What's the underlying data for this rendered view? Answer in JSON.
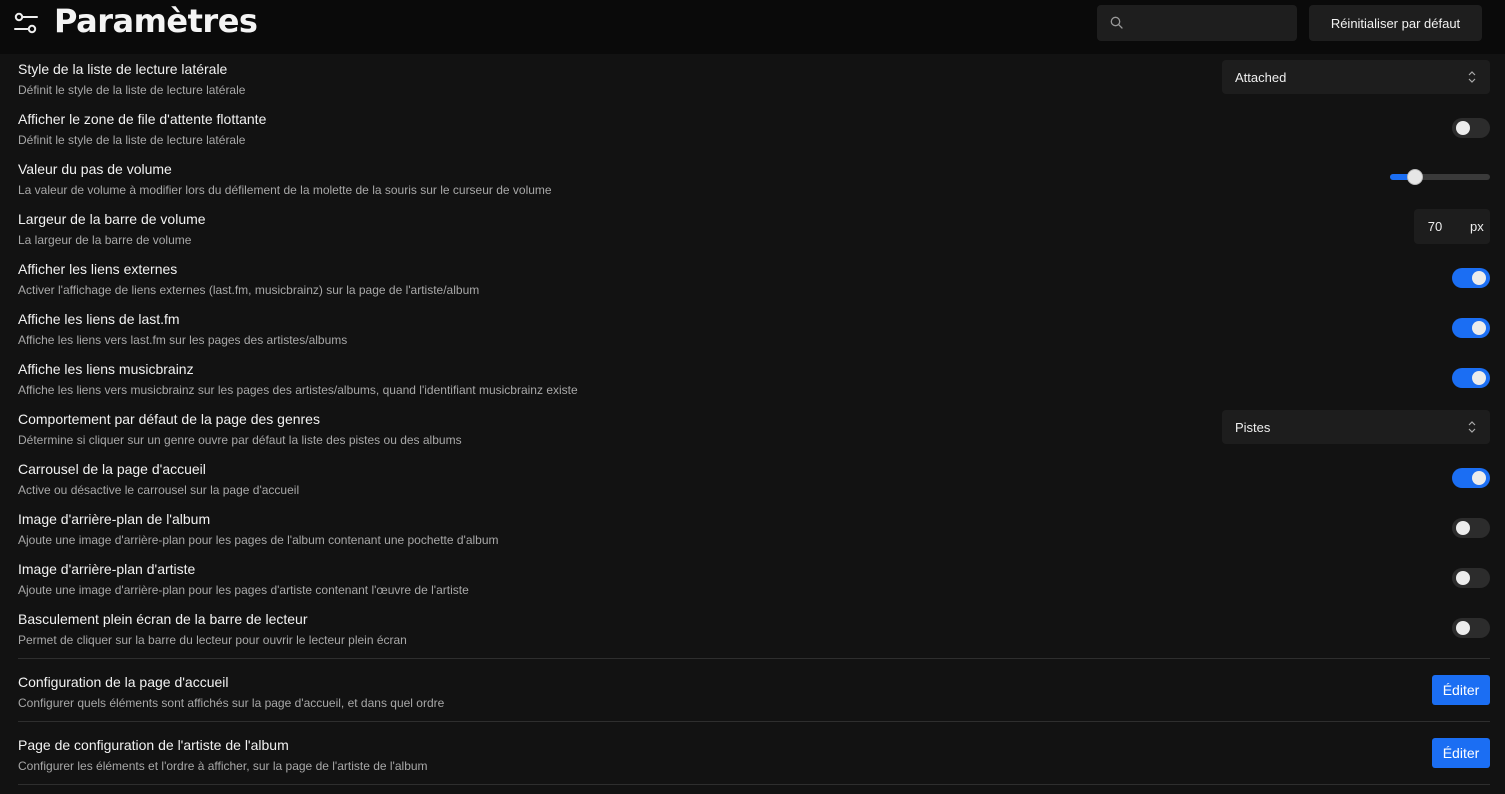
{
  "header": {
    "title": "Paramètres",
    "settings_icon": "sliders-icon",
    "search": {
      "placeholder": "",
      "value": "",
      "icon": "search-icon"
    },
    "reset_label": "Réinitialiser par défaut"
  },
  "settings": [
    {
      "title": "Style de la liste de lecture latérale",
      "description": "Définit le style de la liste de lecture latérale",
      "control": "select",
      "value": "Attached"
    },
    {
      "title": "Afficher le zone de file d'attente flottante",
      "description": "Définit le style de la liste de lecture latérale",
      "control": "toggle",
      "value": false
    },
    {
      "title": "Valeur du pas de volume",
      "description": "La valeur de volume à modifier lors du défilement de la molette de la souris sur le curseur de volume",
      "control": "slider",
      "value": 0.25
    },
    {
      "title": "Largeur de la barre de volume",
      "description": "La largeur de la barre de volume",
      "control": "number",
      "value": "70",
      "unit": "px"
    },
    {
      "title": "Afficher les liens externes",
      "description": "Activer l'affichage de liens externes (last.fm, musicbrainz) sur la page de l'artiste/album",
      "control": "toggle",
      "value": true
    },
    {
      "title": "Affiche les liens de last.fm",
      "description": "Affiche les liens vers last.fm sur les pages des artistes/albums",
      "control": "toggle",
      "value": true
    },
    {
      "title": "Affiche les liens musicbrainz",
      "description": "Affiche les liens vers musicbrainz sur les pages des artistes/albums, quand l'identifiant musicbrainz existe",
      "control": "toggle",
      "value": true
    },
    {
      "title": "Comportement par défaut de la page des genres",
      "description": "Détermine si cliquer sur un genre ouvre par défaut la liste des pistes ou des albums",
      "control": "select",
      "value": "Pistes"
    },
    {
      "title": "Carrousel de la page d'accueil",
      "description": "Active ou désactive le carrousel sur la page d'accueil",
      "control": "toggle",
      "value": true
    },
    {
      "title": "Image d'arrière-plan de l'album",
      "description": "Ajoute une image d'arrière-plan pour les pages de l'album contenant une pochette d'album",
      "control": "toggle",
      "value": false
    },
    {
      "title": "Image d'arrière-plan d'artiste",
      "description": "Ajoute une image d'arrière-plan pour les pages d'artiste contenant l'œuvre de l'artiste",
      "control": "toggle",
      "value": false
    },
    {
      "title": "Basculement plein écran de la barre de lecteur",
      "description": "Permet de cliquer sur la barre du lecteur pour ouvrir le lecteur plein écran",
      "control": "toggle",
      "value": false
    }
  ],
  "config_sections": [
    {
      "title": "Configuration de la page d'accueil",
      "description": "Configurer quels éléments sont affichés sur la page d'accueil, et dans quel ordre",
      "button_label": "Éditer"
    },
    {
      "title": "Page de configuration de l'artiste de l'album",
      "description": "Configurer les éléments et l'ordre à afficher, sur la page de l'artiste de l'album",
      "button_label": "Éditer"
    }
  ],
  "colors": {
    "background": "#121212",
    "header_background": "#0a0a0a",
    "accent": "#1b6ef3",
    "control_background": "#1d1d1d",
    "description_text": "#a8a8a8"
  }
}
